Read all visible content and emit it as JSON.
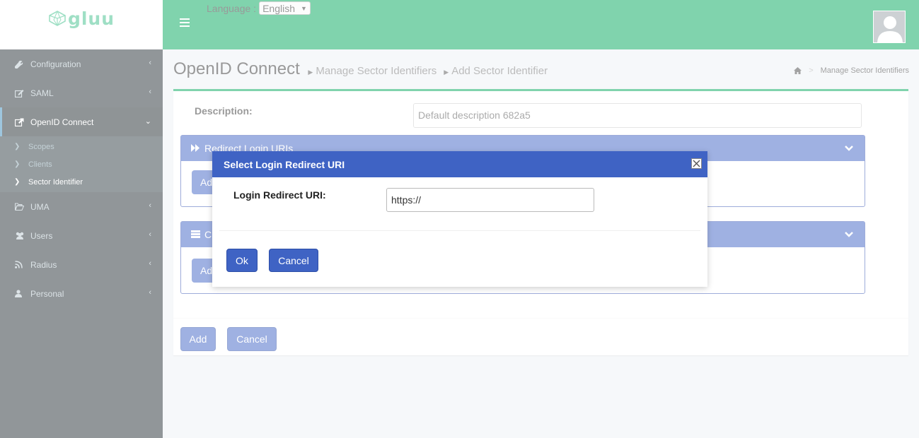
{
  "brand": {
    "logo_text": "gluu"
  },
  "header": {
    "language_label": "Language :",
    "language_selected": "English"
  },
  "sidebar": {
    "items": [
      {
        "label": "Configuration",
        "icon": "wrench-icon"
      },
      {
        "label": "SAML",
        "icon": "edit-icon"
      },
      {
        "label": "OpenID Connect",
        "icon": "external-link-icon"
      },
      {
        "label": "UMA",
        "icon": "folder-open-icon"
      },
      {
        "label": "Users",
        "icon": "users-icon"
      },
      {
        "label": "Radius",
        "icon": "rss-icon"
      },
      {
        "label": "Personal",
        "icon": "user-icon"
      }
    ],
    "openid_sub": [
      {
        "label": "Scopes"
      },
      {
        "label": "Clients"
      },
      {
        "label": "Sector Identifier"
      }
    ]
  },
  "content": {
    "title": "OpenID Connect",
    "crumb1": "Manage Sector Identifiers",
    "crumb2": "Add Sector Identifier",
    "breadcrumb_right": "Manage Sector Identifiers",
    "description_label": "Description:",
    "description_value": "Default description 682a5",
    "panel1_title": "Redirect Login URIs",
    "panel2_title": "C",
    "panel_add_label": "Ad",
    "footer_add": "Add",
    "footer_cancel": "Cancel"
  },
  "modal": {
    "title": "Select Login Redirect URI",
    "field_label": "Login Redirect URI:",
    "field_value": "https://",
    "ok_label": "Ok",
    "cancel_label": "Cancel"
  },
  "colors": {
    "header_green": "#00a65a",
    "primary_blue": "#3f63c4",
    "sidebar_dark": "#222d32"
  }
}
